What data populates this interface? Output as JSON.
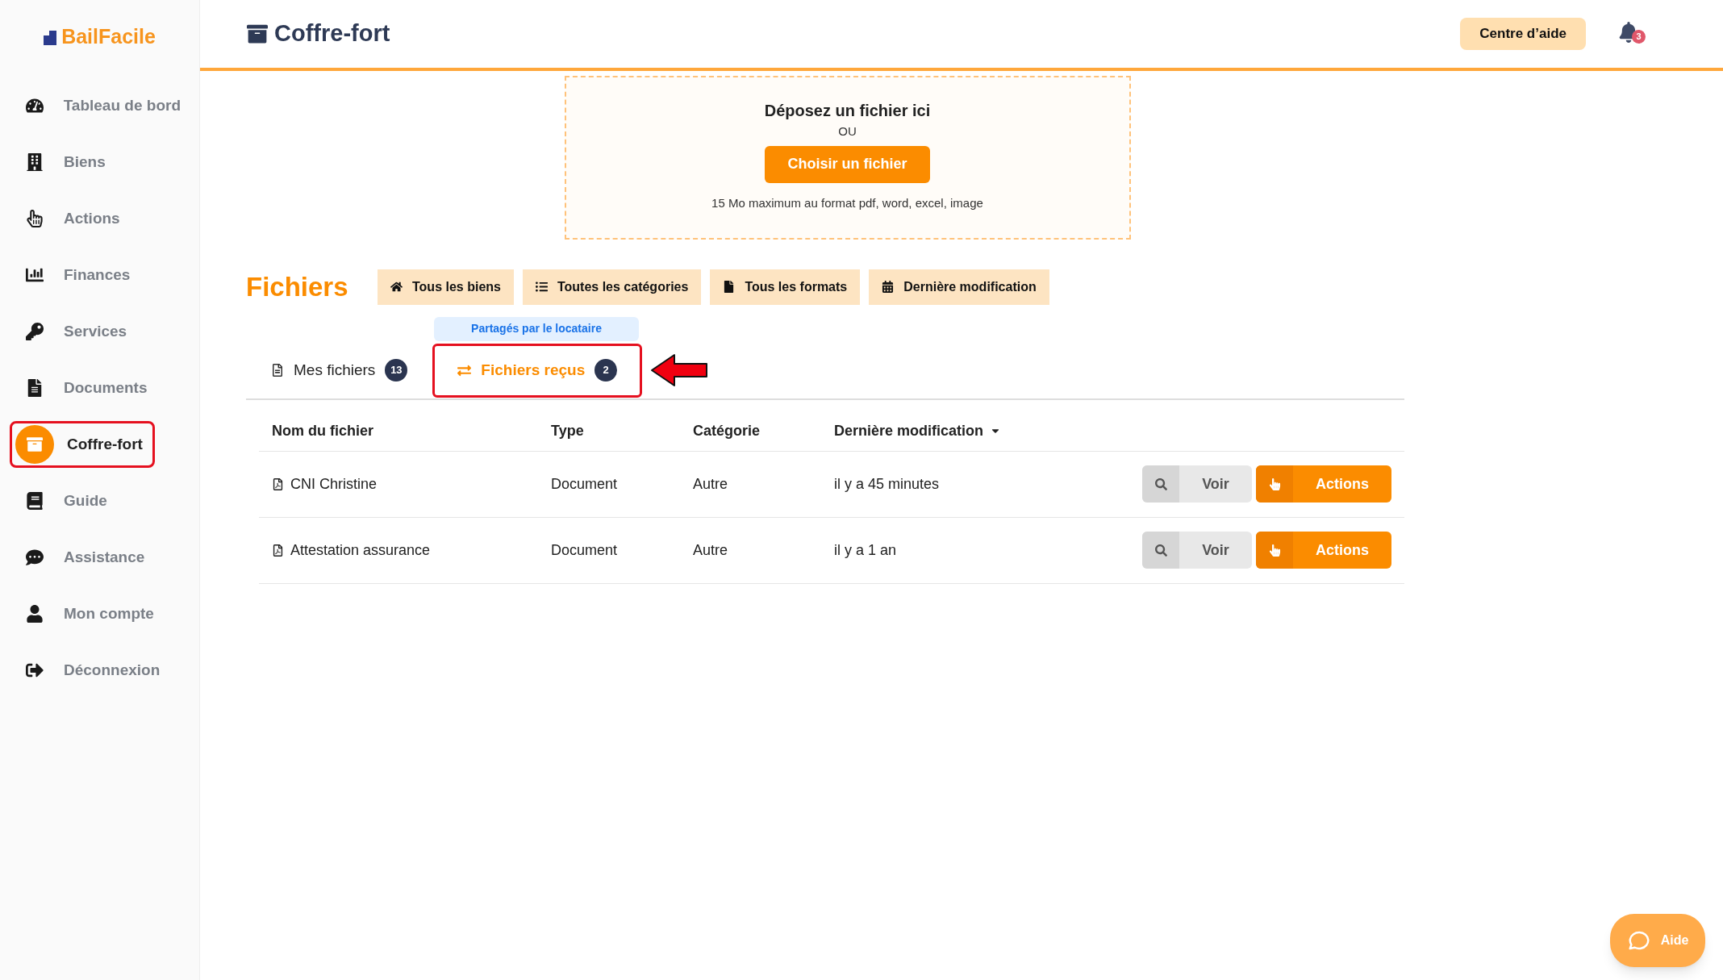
{
  "brand": "BailFacile",
  "sidebar": {
    "items": [
      {
        "label": "Tableau de bord",
        "selected": false,
        "highlighted": false
      },
      {
        "label": "Biens",
        "selected": false,
        "highlighted": false
      },
      {
        "label": "Actions",
        "selected": false,
        "highlighted": false
      },
      {
        "label": "Finances",
        "selected": false,
        "highlighted": false
      },
      {
        "label": "Services",
        "selected": false,
        "highlighted": false
      },
      {
        "label": "Documents",
        "selected": false,
        "highlighted": false
      },
      {
        "label": "Coffre-fort",
        "selected": true,
        "highlighted": true
      },
      {
        "label": "Guide",
        "selected": false,
        "highlighted": false
      },
      {
        "label": "Assistance",
        "selected": false,
        "highlighted": false
      },
      {
        "label": "Mon compte",
        "selected": false,
        "highlighted": false
      },
      {
        "label": "Déconnexion",
        "selected": false,
        "highlighted": false
      }
    ]
  },
  "header": {
    "title": "Coffre-fort",
    "help_button": "Centre d’aide",
    "notification_count": "3"
  },
  "upload": {
    "title": "Déposez un fichier ici",
    "separator": "OU",
    "button": "Choisir un fichier",
    "hint": "15 Mo maximum au format pdf, word, excel, image"
  },
  "files": {
    "title": "Fichiers",
    "filters": [
      "Tous les biens",
      "Toutes les catégories",
      "Tous les formats",
      "Dernière modification"
    ],
    "tab_hint": "Partagés par le locataire",
    "tabs": [
      {
        "label": "Mes fichiers",
        "count": "13",
        "selected": false,
        "highlighted": false
      },
      {
        "label": "Fichiers reçus",
        "count": "2",
        "selected": true,
        "highlighted": true
      }
    ],
    "table": {
      "columns": [
        "Nom du fichier",
        "Type",
        "Catégorie",
        "Dernière modification"
      ],
      "rows": [
        {
          "name": "CNI Christine",
          "type": "Document",
          "category": "Autre",
          "modified": "il y a 45 minutes",
          "view": "Voir",
          "actions": "Actions"
        },
        {
          "name": "Attestation assurance",
          "type": "Document",
          "category": "Autre",
          "modified": "il y a 1 an",
          "view": "Voir",
          "actions": "Actions"
        }
      ]
    }
  },
  "help_widget": "Aide"
}
